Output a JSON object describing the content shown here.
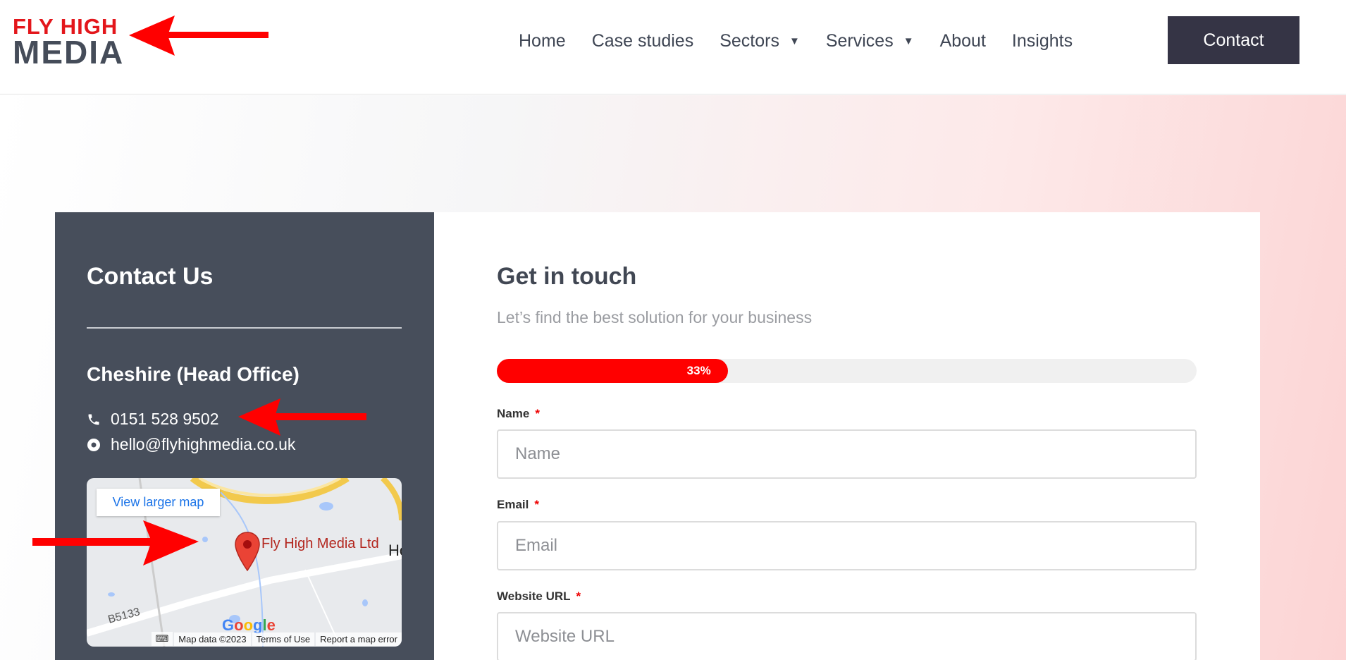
{
  "logo": {
    "line1": "FLY HIGH",
    "line2": "MEDIA"
  },
  "nav": {
    "items": [
      {
        "label": "Home",
        "dropdown": false
      },
      {
        "label": "Case studies",
        "dropdown": false
      },
      {
        "label": "Sectors",
        "dropdown": true
      },
      {
        "label": "Services",
        "dropdown": true
      },
      {
        "label": "About",
        "dropdown": false
      },
      {
        "label": "Insights",
        "dropdown": false
      }
    ],
    "contact_label": "Contact",
    "caret": "▼"
  },
  "contact_panel": {
    "title": "Contact Us",
    "office": "Cheshire (Head Office)",
    "phone": "0151 528 9502",
    "email": "hello@flyhighmedia.co.uk",
    "map": {
      "view_larger": "View larger map",
      "place": "Fly High Media Ltd",
      "partial_label": "Ho",
      "road": "B5133",
      "google": "Google",
      "map_data": "Map data ©2023",
      "terms": "Terms of Use",
      "report": "Report a map error"
    }
  },
  "form": {
    "title": "Get in touch",
    "subtitle": "Let’s find the best solution for your business",
    "progress": {
      "percent": 33,
      "label": "33%"
    },
    "fields": [
      {
        "label": "Name",
        "required": "*",
        "placeholder": "Name"
      },
      {
        "label": "Email",
        "required": "*",
        "placeholder": "Email"
      },
      {
        "label": "Website URL",
        "required": "*",
        "placeholder": "Website URL"
      }
    ]
  },
  "colors": {
    "accent": "#ff0000",
    "dark_panel": "#474e5b",
    "button": "#353445",
    "annotation_arrow": "#ff0000"
  }
}
